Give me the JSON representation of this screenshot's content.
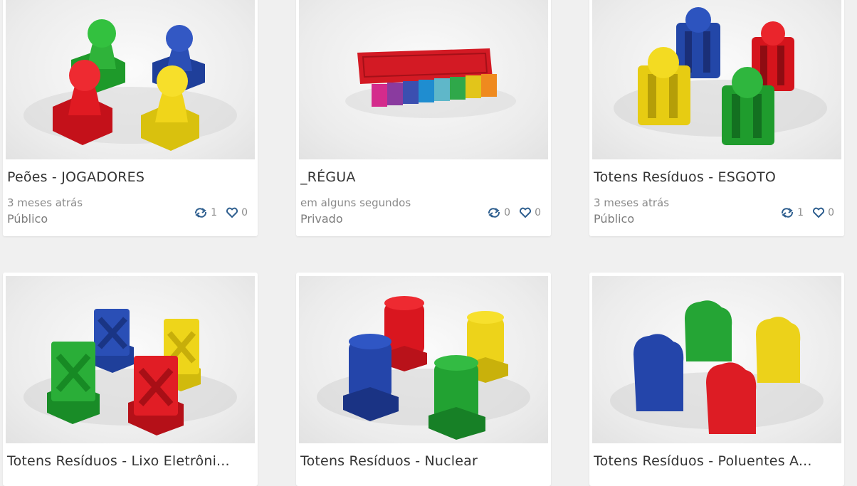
{
  "colors": {
    "background": "#f0f0f0",
    "card": "#ffffff",
    "icon": "#2f5f8f"
  },
  "icons": {
    "copy": "copy-icon",
    "like": "heart-icon"
  },
  "designs": [
    {
      "title": "Peões - JOGADORES",
      "time": "3 meses atrás",
      "visibility": "Público",
      "copies": "1",
      "likes": "0"
    },
    {
      "title": "_RÉGUA",
      "time": "em alguns segundos",
      "visibility": "Privado",
      "copies": "0",
      "likes": "0"
    },
    {
      "title": "Totens Resíduos - ESGOTO",
      "time": "3 meses atrás",
      "visibility": "Público",
      "copies": "1",
      "likes": "0"
    },
    {
      "title": "Totens Resíduos - Lixo Eletrôni..."
    },
    {
      "title": "Totens Resíduos - Nuclear"
    },
    {
      "title": "Totens Resíduos - Poluentes A..."
    }
  ]
}
